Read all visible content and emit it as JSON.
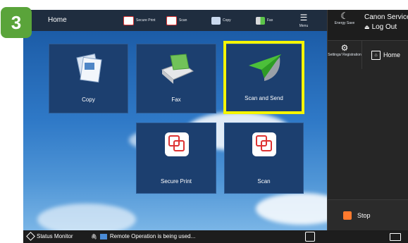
{
  "step_badge": "3",
  "topbar": {
    "title": "Home",
    "shortcuts": [
      {
        "label": "Secure Print",
        "icon": "secure-print-icon"
      },
      {
        "label": "Scan",
        "icon": "scan-icon"
      },
      {
        "label": "Copy",
        "icon": "copy-icon"
      },
      {
        "label": "Fax",
        "icon": "fax-icon"
      }
    ],
    "menu_label": "Menu"
  },
  "right_panel": {
    "energy_label": "Energy Save",
    "account_name": "Canon Service Acco",
    "logout_label": "Log Out",
    "settings_label": "Settings/ Registration",
    "home_label": "Home",
    "stop_label": "Stop"
  },
  "tiles": {
    "copy": "Copy",
    "fax": "Fax",
    "scan_send": "Scan and Send",
    "secure_print": "Secure Print",
    "scan": "Scan"
  },
  "statusbar": {
    "status_monitor": "Status Monitor",
    "remote_message": "Remote Operation is being used..."
  },
  "colors": {
    "highlight": "#f5f500",
    "badge": "#5aa43a",
    "stop": "#ff7a2e"
  }
}
